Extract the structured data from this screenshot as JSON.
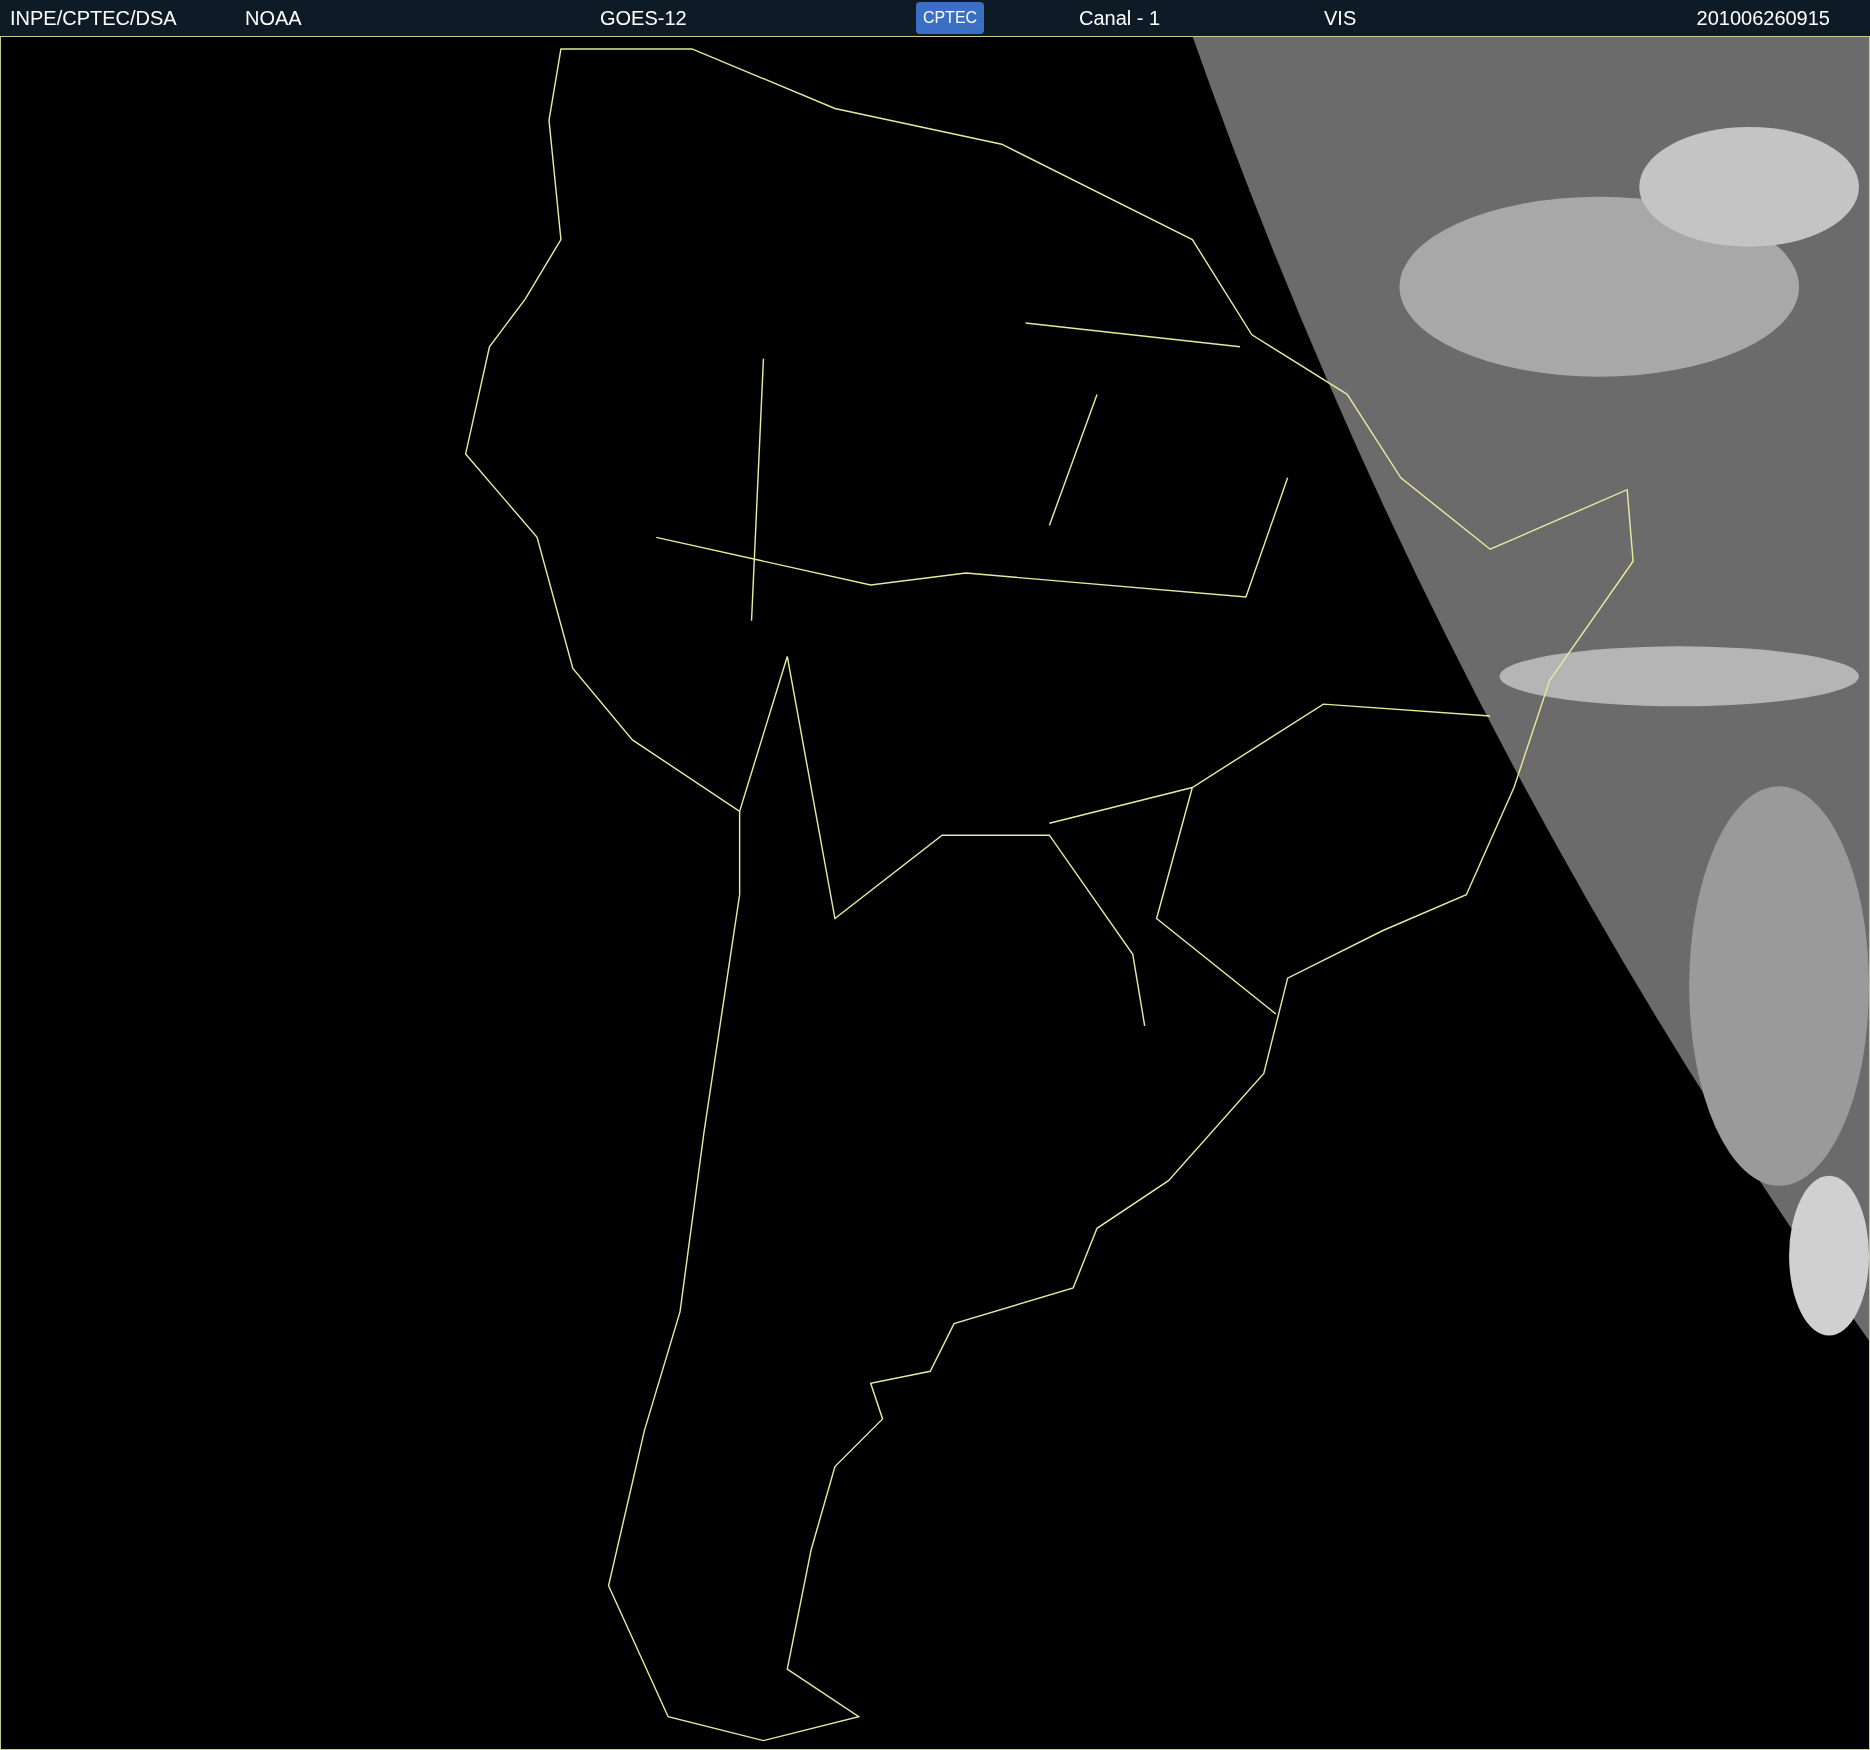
{
  "header": {
    "source": "INPE/CPTEC/DSA",
    "agency": "NOAA",
    "satellite": "GOES-12",
    "logo": "CPTEC",
    "channel": "Canal - 1",
    "band": "VIS",
    "timestamp": "201006260915"
  }
}
